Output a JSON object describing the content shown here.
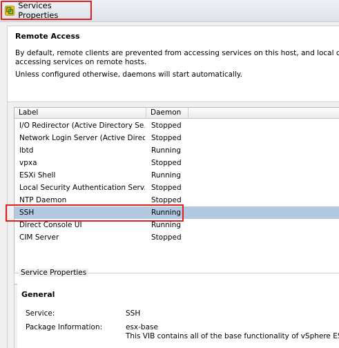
{
  "window": {
    "title": "Services Properties"
  },
  "remote_access": {
    "heading": "Remote Access",
    "description_line1": "By default, remote clients are prevented from accessing services on this host, and local clients are",
    "description_line2": "accessing services on remote hosts.",
    "note": "Unless configured otherwise, daemons will start automatically."
  },
  "table": {
    "columns": [
      "Label",
      "Daemon"
    ],
    "rows": [
      {
        "label": "I/O Redirector (Active Directory Se...",
        "daemon": "Stopped"
      },
      {
        "label": "Network Login Server (Active Direc...",
        "daemon": "Stopped"
      },
      {
        "label": "lbtd",
        "daemon": "Running"
      },
      {
        "label": "vpxa",
        "daemon": "Stopped"
      },
      {
        "label": "ESXi Shell",
        "daemon": "Running"
      },
      {
        "label": "Local Security Authentication Serv...",
        "daemon": "Stopped"
      },
      {
        "label": "NTP Daemon",
        "daemon": "Stopped"
      },
      {
        "label": "SSH",
        "daemon": "Running"
      },
      {
        "label": "Direct Console UI",
        "daemon": "Running"
      },
      {
        "label": "CIM Server",
        "daemon": "Stopped"
      }
    ],
    "selected_index": 7
  },
  "service_properties": {
    "legend": "Service Properties",
    "general_heading": "General",
    "service_label": "Service:",
    "service_value": "SSH",
    "package_label": "Package Information:",
    "package_value": "esx-base",
    "package_description": "This VIB contains all of the base functionality of vSphere ESXi."
  },
  "colors": {
    "selection": "#b3c8e1",
    "highlight_border": "#e02020",
    "app_icon": "#7aa83a"
  }
}
